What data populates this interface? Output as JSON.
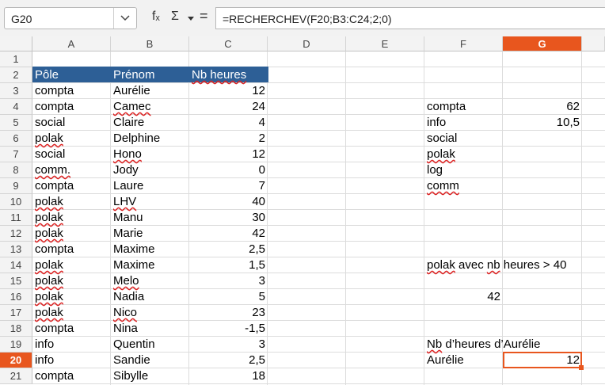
{
  "name_box": "G20",
  "formula": "=RECHERCHEV(F20;B3:C24;2;0)",
  "formula_icons": {
    "fx": "fₓ",
    "sigma": "Σ",
    "equals": "="
  },
  "columns": [
    "A",
    "B",
    "C",
    "D",
    "E",
    "F",
    "G"
  ],
  "selected_column": "G",
  "rows": [
    1,
    2,
    3,
    4,
    5,
    6,
    7,
    8,
    9,
    10,
    11,
    12,
    13,
    14,
    15,
    16,
    17,
    18,
    19,
    20,
    21
  ],
  "selected_row": 20,
  "headers": {
    "a": "Pôle",
    "b": "Prénom",
    "c": "Nb heures"
  },
  "table": [
    {
      "pole": "compta",
      "prenom": "Aurélie",
      "heures": "12"
    },
    {
      "pole": "compta",
      "prenom": "Camec",
      "heures": "24"
    },
    {
      "pole": "social",
      "prenom": "Claire",
      "heures": "4"
    },
    {
      "pole": "polak",
      "prenom": "Delphine",
      "heures": "2"
    },
    {
      "pole": "social",
      "prenom": "Hono",
      "heures": "12"
    },
    {
      "pole": "comm.",
      "prenom": "Jody",
      "heures": "0"
    },
    {
      "pole": "compta",
      "prenom": "Laure",
      "heures": "7"
    },
    {
      "pole": "polak",
      "prenom": "LHV",
      "heures": "40"
    },
    {
      "pole": "polak",
      "prenom": "Manu",
      "heures": "30"
    },
    {
      "pole": "polak",
      "prenom": "Marie",
      "heures": "42"
    },
    {
      "pole": "compta",
      "prenom": "Maxime",
      "heures": "2,5"
    },
    {
      "pole": "polak",
      "prenom": "Maxime",
      "heures": "1,5"
    },
    {
      "pole": "polak",
      "prenom": "Melo",
      "heures": "3"
    },
    {
      "pole": "polak",
      "prenom": "Nadia",
      "heures": "5"
    },
    {
      "pole": "polak",
      "prenom": "Nico",
      "heures": "23"
    },
    {
      "pole": "compta",
      "prenom": "Nina",
      "heures": "-1,5"
    },
    {
      "pole": "info",
      "prenom": "Quentin",
      "heures": "3"
    },
    {
      "pole": "info",
      "prenom": "Sandie",
      "heures": "2,5"
    },
    {
      "pole": "compta",
      "prenom": "Sibylle",
      "heures": "18"
    }
  ],
  "summary": [
    {
      "label": "compta",
      "value": "62"
    },
    {
      "label": "info",
      "value": "10,5"
    },
    {
      "label": "social",
      "value": ""
    },
    {
      "label": "polak",
      "value": ""
    },
    {
      "label": "log",
      "value": ""
    },
    {
      "label": "comm",
      "value": ""
    }
  ],
  "polak_label": "polak avec nb heures > 40",
  "polak_value": "42",
  "lookup_label": "Nb d’heures d’Aurélie",
  "lookup_name": "Aurélie",
  "lookup_value": "12"
}
